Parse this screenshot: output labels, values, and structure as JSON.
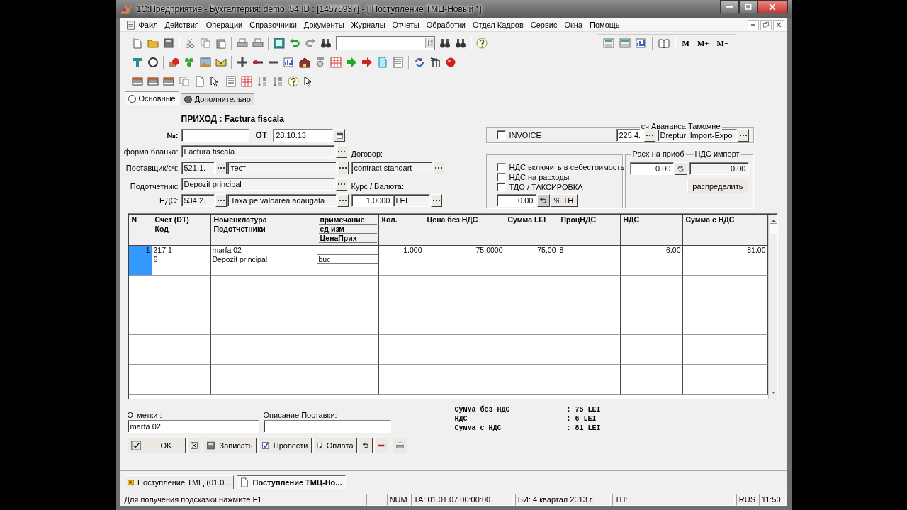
{
  "window": {
    "title": "1С:Предприятие - Бухгалтерия: demo :54 ID : [14575937] - [ Поступление ТМЦ-Новый *]"
  },
  "menu": [
    "Файл",
    "Действия",
    "Операции",
    "Справочники",
    "Документы",
    "Журналы",
    "Отчеты",
    "Обработки",
    "Отдел Кадров",
    "Сервис",
    "Окна",
    "Помощь"
  ],
  "memory_buttons": [
    "M",
    "M+",
    "M−"
  ],
  "tabs": [
    {
      "label": "Основные",
      "selected": true
    },
    {
      "label": "Дополнительно",
      "selected": false
    }
  ],
  "form": {
    "heading": "ПРИХОД : Factura fiscala",
    "number_label": "№:",
    "date_label": "ОТ",
    "date": "28.10.13",
    "fields": [
      {
        "label": "форма бланка:",
        "values": [
          "Factura fiscala"
        ]
      },
      {
        "label": "Поставщик/сч:",
        "values": [
          "521.1.",
          "тест"
        ]
      },
      {
        "label": "Подотчетник:",
        "values": [
          "Depozit principal"
        ]
      },
      {
        "label": "НДС:",
        "values": [
          "534.2.",
          "Taxa pe valoarea adaugata"
        ]
      }
    ],
    "contract": {
      "label": "Договор:",
      "value": "contract standart"
    },
    "rate": {
      "label": "Курс / Валюта:",
      "value": "1.0000",
      "currency": "LEI"
    },
    "invoice": {
      "label": "INVOICE",
      "checked": false
    },
    "advance": {
      "legend": "сч Авананса  Таможне",
      "account": "225.4.",
      "value": "Drepturi Import-Expo"
    },
    "options": [
      {
        "label": "НДС включить в себестоимость",
        "checked": false
      },
      {
        "label": "НДС на расходы",
        "checked": false
      },
      {
        "label": "ТДО / ТАКСИРОВКА",
        "checked": false
      }
    ],
    "percent": {
      "value": "0.00",
      "button": "% ТН"
    },
    "costs": {
      "legend": "Расх на приоб",
      "value": "0.00"
    },
    "import_vat": {
      "legend": "НДС импорт",
      "value": "0.00"
    },
    "distribute_button": "распределить"
  },
  "table": {
    "columns": [
      {
        "lines": [
          "N"
        ]
      },
      {
        "lines": [
          "Счет (DT)",
          "Код"
        ]
      },
      {
        "lines": [
          "Номенклатура",
          "Подотчетники"
        ]
      },
      {
        "lines": [
          "примечание",
          "ед изм",
          "ЦенаПрих"
        ]
      },
      {
        "lines": [
          "Кол."
        ]
      },
      {
        "lines": [
          "Цена без НДС"
        ]
      },
      {
        "lines": [
          "Сумма LEI"
        ]
      },
      {
        "lines": [
          "ПроцНДС"
        ]
      },
      {
        "lines": [
          "НДС"
        ]
      },
      {
        "lines": [
          "Сумма с НДС"
        ]
      }
    ],
    "rows": [
      {
        "number": "1",
        "selected": true,
        "account": "217.1",
        "code": "6",
        "item": "marfa 02",
        "holder": "Depozit principal",
        "unit": "buc",
        "qty": "1.000",
        "price": "75.0000",
        "sum": "75.00",
        "vat_rate": "8",
        "vat": "6.00",
        "total": "81.00"
      }
    ]
  },
  "notes": {
    "label": "Отметки :",
    "value": "marfa 02"
  },
  "delivery": {
    "label": "Описание Поставки:"
  },
  "totals": [
    {
      "label": "Сумма без НДС",
      "value": ": 75 LEI"
    },
    {
      "label": "НДС",
      "value": ": 6 LEI"
    },
    {
      "label": "Сумма с НДС",
      "value": ": 81 LEI"
    }
  ],
  "buttons": [
    {
      "kind": "ok",
      "label": "OK"
    },
    {
      "kind": "cancel"
    },
    {
      "kind": "save",
      "label": "Записать"
    },
    {
      "kind": "post",
      "label": "Провести"
    },
    {
      "kind": "pay",
      "label": "Оплата"
    },
    {
      "kind": "undo"
    },
    {
      "kind": "remove"
    },
    {
      "kind": "print"
    }
  ],
  "window_tabs": [
    {
      "label": "Поступление ТМЦ (01.0...",
      "selected": false
    },
    {
      "label": "Поступление ТМЦ-Но...",
      "selected": true
    }
  ],
  "status_bar": {
    "hint": "Для получения подсказки нажмите F1",
    "panels": [
      "NUM",
      "ТА: 01.01.07  00:00:00",
      "БИ: 4 квартал 2013 г.",
      "ТП:",
      "RUS",
      "11:50"
    ]
  }
}
